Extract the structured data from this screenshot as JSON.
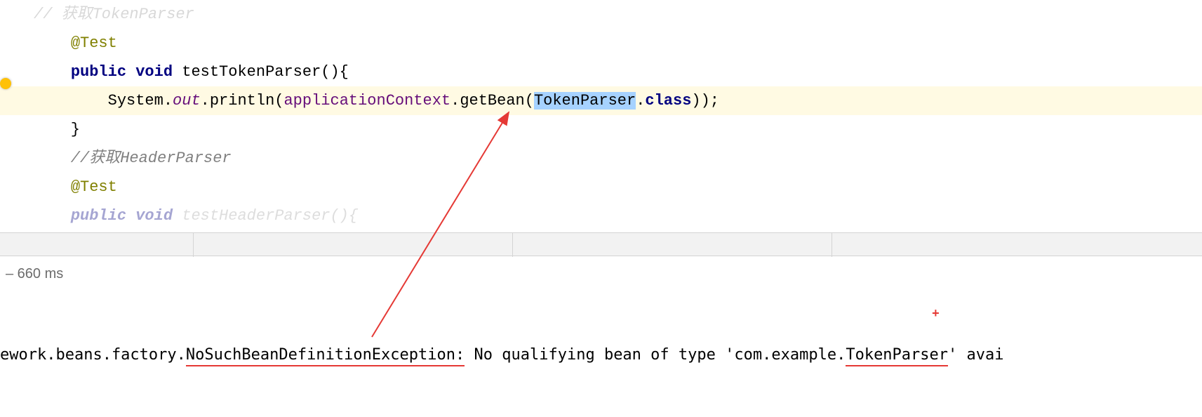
{
  "editor": {
    "line1_comment": "// 获取TokenParser",
    "line2": "@Test",
    "line3_public": "public",
    "line3_void": "void",
    "line3_method": " testTokenParser(){",
    "line4_indent": "        System.",
    "line4_out": "out",
    "line4_println": ".println(",
    "line4_appctx": "applicationContext",
    "line4_getbean": ".getBean(",
    "line4_tokenparser": "TokenParser",
    "line4_dot": ".",
    "line4_class": "class",
    "line4_end": "));",
    "line5": "    }",
    "line6": "",
    "line7_comment": "    //获取HeaderParser",
    "line8": "@Test",
    "line9_public": "public",
    "line9_void": "void",
    "line9_method": " testHeaderParser(){"
  },
  "run": {
    "status": "– 660 ms"
  },
  "console": {
    "prefix": "ework.beans.factory.",
    "exception": "NoSuchBeanDefinitionException:",
    "mid": " No qualifying bean of type '",
    "pkg": "com.example.",
    "cls": "TokenParser",
    "suffix": "' avai"
  },
  "annotation": {
    "plus": "+"
  }
}
